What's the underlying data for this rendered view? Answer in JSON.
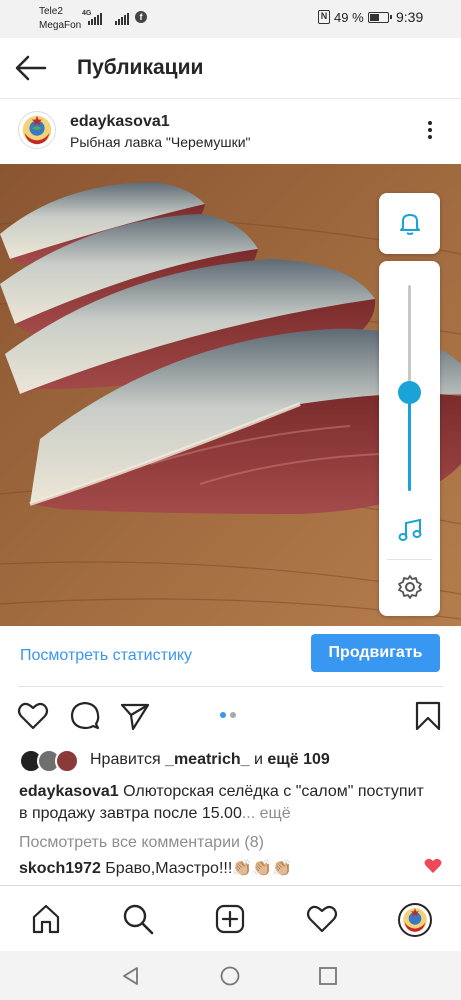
{
  "status_bar": {
    "carrier_1": "Tele2",
    "carrier_2": "MegaFon",
    "network": "4G",
    "battery_percent": "49 %",
    "time": "9:39",
    "nfc_label": "N"
  },
  "header": {
    "title": "Публикации"
  },
  "post": {
    "username": "edaykasova1",
    "location": "Рыбная лавка \"Черемушки\"",
    "carousel": {
      "slides": 2,
      "active": 1
    }
  },
  "volume_panel": {
    "level_percent": 48,
    "accent_color": "#1aa3d6"
  },
  "insights": {
    "stats_link": "Посмотреть статистику",
    "promote_button": "Продвигать"
  },
  "likes": {
    "prefix": "Нравится ",
    "user": "_meatrich_",
    "middle": " и ",
    "count_text": "ещё 109"
  },
  "caption": {
    "username": "edaykasova1",
    "text": " Олюторская селёдка с \"салом\" поступит в продажу завтра после 15.00",
    "more": "... ещё"
  },
  "comments": {
    "view_all": "Посмотреть все комментарии (8)",
    "items": [
      {
        "username": "skoch1972",
        "text": " Браво,Маэстро!!!👏🏼👏🏼👏🏼"
      }
    ]
  },
  "colors": {
    "link_blue": "#3897f0",
    "like_red": "#ed4956",
    "text": "#262626",
    "muted": "#8e8e8e"
  },
  "icons": {
    "back": "arrow-left-icon",
    "more": "vertical-dots-icon",
    "like": "heart-icon",
    "comment": "speech-bubble-icon",
    "share": "paper-plane-icon",
    "save": "bookmark-icon",
    "nav_home": "home-icon",
    "nav_search": "search-icon",
    "nav_add": "plus-square-icon",
    "nav_activity": "heart-icon",
    "vol_bell": "bell-icon",
    "vol_music": "music-note-icon",
    "vol_settings": "gear-icon"
  }
}
